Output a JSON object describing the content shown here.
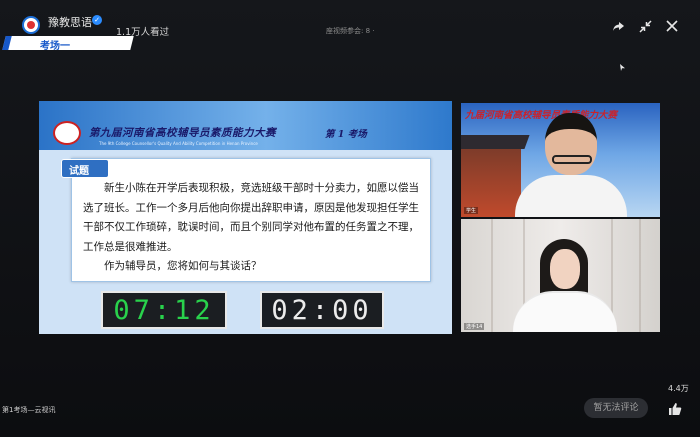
{
  "header": {
    "channel_name": "豫教思语",
    "verified_mark": "✓",
    "viewer_count": "1.1万人看过",
    "venue_tag": "考场一",
    "ticker_text": "座视频参会: 8 ·"
  },
  "slide": {
    "title": "第九届河南省高校辅导员素质能力大赛",
    "subtitle": "The 9th College Counsellor's Quality And Ability Competition in Henan Province",
    "stage_no": "第 1 考场",
    "question_tab": "试题",
    "question_text": "新生小陈在开学后表现积极，竞选班级干部时十分卖力，如愿以偿当选了班长。工作一个多月后他向你提出辞职申请，原因是他发现担任学生干部不仅工作琐碎，耽误时间，而且个别同学对他布置的任务置之不理，工作总是很难推进。",
    "question_prompt": "作为辅导员，您将如何与其谈话？",
    "timer_elapsed": "07:12",
    "timer_limit": "02:00",
    "timer_colors": {
      "elapsed": "#29d24c",
      "limit": "#ececec"
    }
  },
  "videos": {
    "candidate_banner": "九届河南省高校辅导员素质能力大赛",
    "candidate_tag": "学生",
    "judge_tag": "选手14"
  },
  "footer": {
    "like_count": "4.4万",
    "comment_placeholder": "暂无法评论",
    "caption": "第1考场—云视讯"
  },
  "icons": {
    "share": "share-icon",
    "collapse": "collapse-icon",
    "close": "close-icon",
    "like": "thumbs-up-icon"
  },
  "colors": {
    "brand_blue": "#1758c9",
    "background": "#0f1115"
  }
}
